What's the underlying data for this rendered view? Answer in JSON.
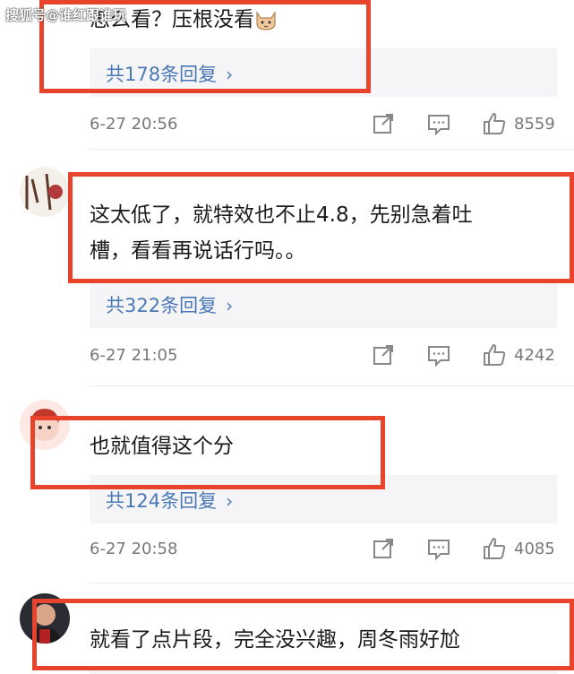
{
  "watermark": "搜狐号@谁红跟谁玩",
  "colors": {
    "highlight": "#e8432d",
    "link": "#4a78b5",
    "meta": "#777777"
  },
  "comments": [
    {
      "text": "怎么看？压根没看",
      "emoji": "cat-face-emoji",
      "reply_label": "共178条回复",
      "time": "6-27 20:56",
      "likes": "8559"
    },
    {
      "text_line1": "这太低了，就特效也不止4.8，先别急着吐",
      "text_line2": "槽，看看再说话行吗。。",
      "reply_label": "共322条回复",
      "time": "6-27 21:05",
      "likes": "4242"
    },
    {
      "text": "也就值得这个分",
      "reply_label": "共124条回复",
      "time": "6-27 20:58",
      "likes": "4085"
    },
    {
      "text": "就看了点片段，完全没兴趣，周冬雨好尬"
    }
  ]
}
